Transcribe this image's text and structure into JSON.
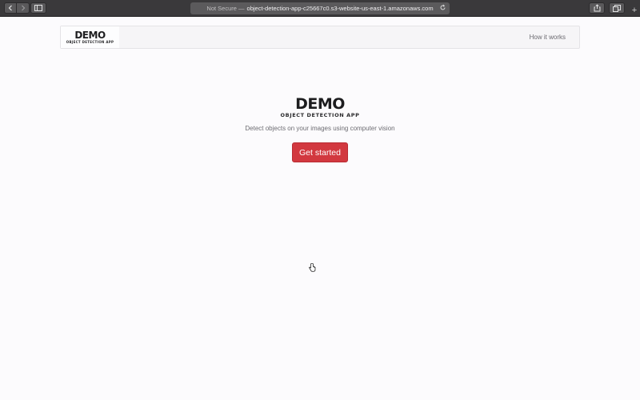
{
  "browser": {
    "security_label": "Not Secure —",
    "url": "object-detection-app-c25667c0.s3-website-us-east-1.amazonaws.com",
    "new_tab_label": "+",
    "icons": [
      "back-icon",
      "forward-icon",
      "sidebar-icon",
      "reload-icon",
      "share-icon",
      "tabs-icon"
    ]
  },
  "navbar": {
    "logo_title": "DEMO",
    "logo_subtitle": "OBJECT DETECTION APP",
    "link_how_it_works": "How it works"
  },
  "hero": {
    "logo_title": "DEMO",
    "logo_subtitle": "OBJECT DETECTION APP",
    "tagline": "Detect objects on your images using computer vision",
    "cta_label": "Get started"
  },
  "colors": {
    "accent": "#d2383f",
    "page_background": "#fcfbfd",
    "chrome": "#3a393b"
  }
}
